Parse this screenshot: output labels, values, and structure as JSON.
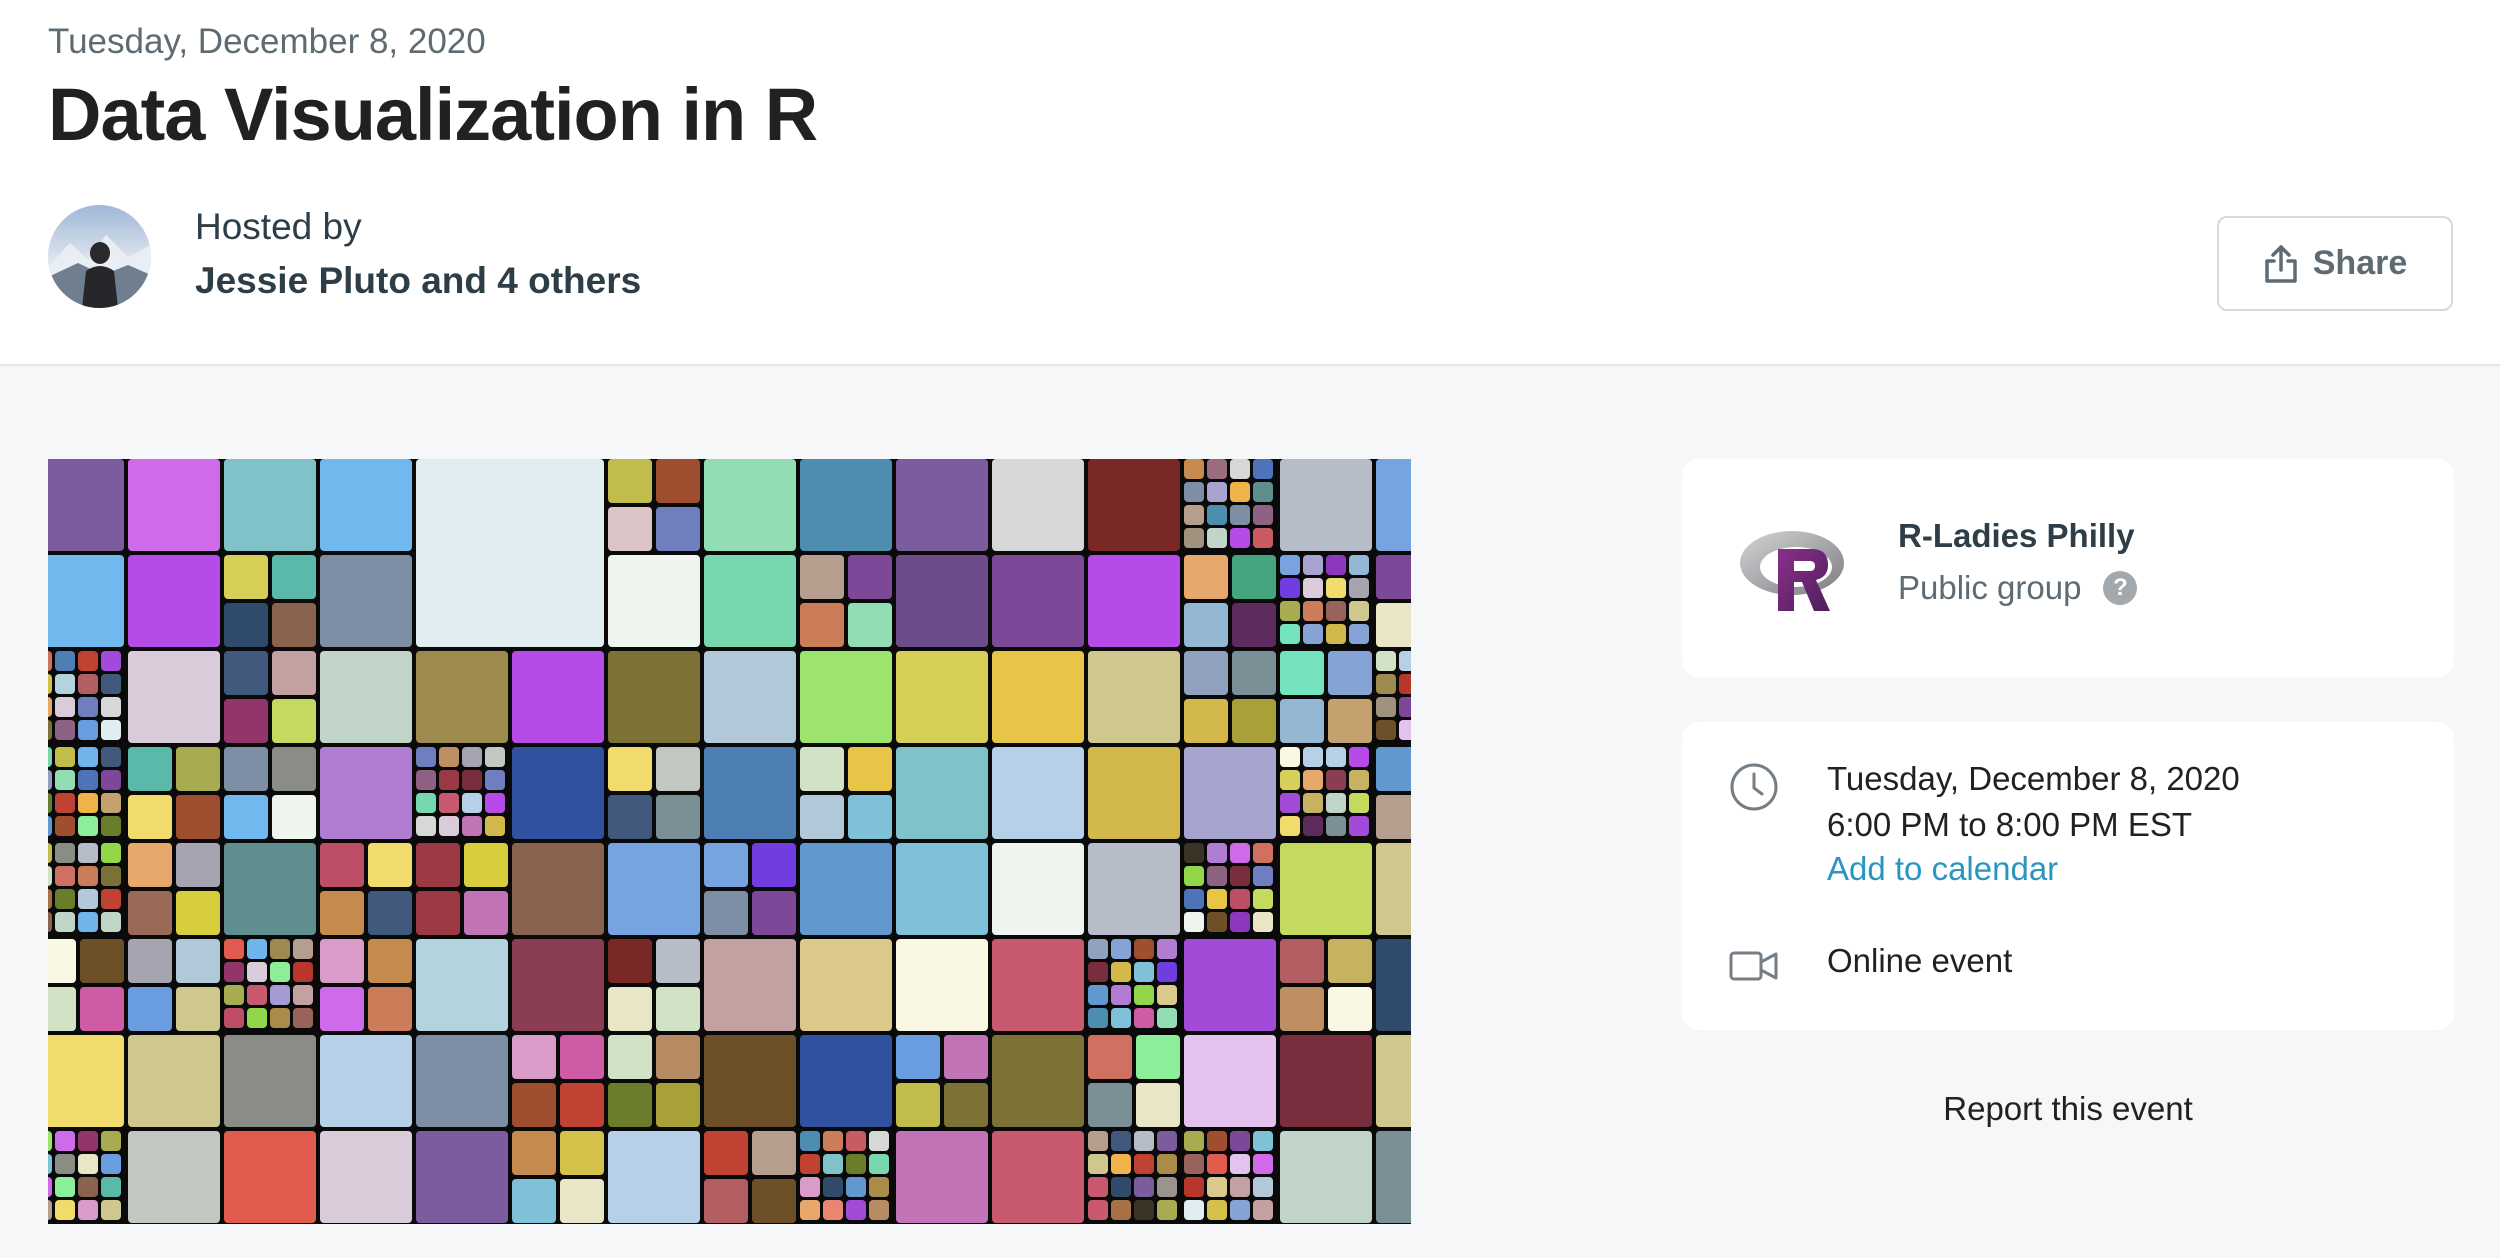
{
  "header": {
    "date": "Tuesday, December 8, 2020",
    "title": "Data Visualization in R",
    "hosted_label": "Hosted by",
    "hosted_names": "Jessie Pluto and 4 others",
    "share_label": "Share",
    "avatar_icon": "host-avatar-photo"
  },
  "event_image": {
    "icon": "treemap-art-image",
    "palette": [
      "#cfc88e",
      "#d99bc8",
      "#dacbdb",
      "#b6d0e8",
      "#e1eef1",
      "#eef4ee",
      "#e8f0e2",
      "#9c8a4e",
      "#c5a170",
      "#d1e2c6",
      "#e9e6c8",
      "#fbf7e5",
      "#dbc98b",
      "#c58b4e",
      "#e6a96b",
      "#8a634f",
      "#c2a1a0",
      "#8e6282",
      "#b2c9d9",
      "#d5d8d6",
      "#c3c7c2",
      "#a0937d",
      "#bd8f63",
      "#a87145",
      "#8d36bf",
      "#a34bd9",
      "#b64be8",
      "#cf6be8",
      "#7ec1d9",
      "#b3d4df",
      "#94b8d4",
      "#c0d4c8",
      "#dcc5c7",
      "#ab8b48",
      "#6d5028",
      "#c8596e",
      "#cb7d5a",
      "#5f8e8f",
      "#7a9096",
      "#b6bdc8",
      "#86a3d6",
      "#a49ad5",
      "#e3c2ee",
      "#c074b5",
      "#f1db6c",
      "#d6cf58",
      "#c1bd4a",
      "#9a6c7e",
      "#cf5aa6",
      "#7d4897",
      "#7e8ea5",
      "#8fa1bf",
      "#b07dd3",
      "#d4c14a",
      "#e7c647",
      "#c4da5e",
      "#93ddb5",
      "#7fc3c8",
      "#7a2d3c",
      "#9b3a45",
      "#8b3d54",
      "#4e73b8",
      "#a7a4cf",
      "#7b5c9c",
      "#be4d66",
      "#e98672",
      "#d07060",
      "#b8362c",
      "#d7ce3d",
      "#92d74a",
      "#9ce46d",
      "#8dee99",
      "#75e3c0",
      "#5bb9aa",
      "#6f7ebf",
      "#4d8db0",
      "#77d7ae",
      "#98635a",
      "#b35e62",
      "#c04233",
      "#9a6a56",
      "#8a8d86",
      "#c7b261",
      "#d3b84b",
      "#a9ab51",
      "#2f4a6b",
      "#44a57e",
      "#c95c62",
      "#9f4e2f",
      "#7d7236",
      "#b78b63",
      "#9b938d",
      "#3b3426",
      "#40597c",
      "#6d4c8c",
      "#92356b",
      "#5e2b5e",
      "#6f3de0",
      "#6a9de0",
      "#70b8ed",
      "#6198d0",
      "#4d7fb5",
      "#3050a0",
      "#6fb4ea",
      "#77a3e0",
      "#a8a038",
      "#7a2826",
      "#b59e8d",
      "#a6a4b0",
      "#6a7d2a",
      "#ea9950",
      "#f0b34a",
      "#e25b4f"
    ]
  },
  "group": {
    "logo_icon": "r-logo-icon",
    "name": "R-Ladies Philly",
    "type": "Public group",
    "help_glyph": "?"
  },
  "details": {
    "clock_icon": "clock-icon",
    "date_line": "Tuesday, December 8, 2020",
    "time_line": "6:00 PM to 8:00 PM EST",
    "add_to_calendar": "Add to calendar",
    "video_icon": "video-camera-icon",
    "location": "Online event",
    "link_color": "#2b95c1"
  },
  "report_label": "Report this event"
}
